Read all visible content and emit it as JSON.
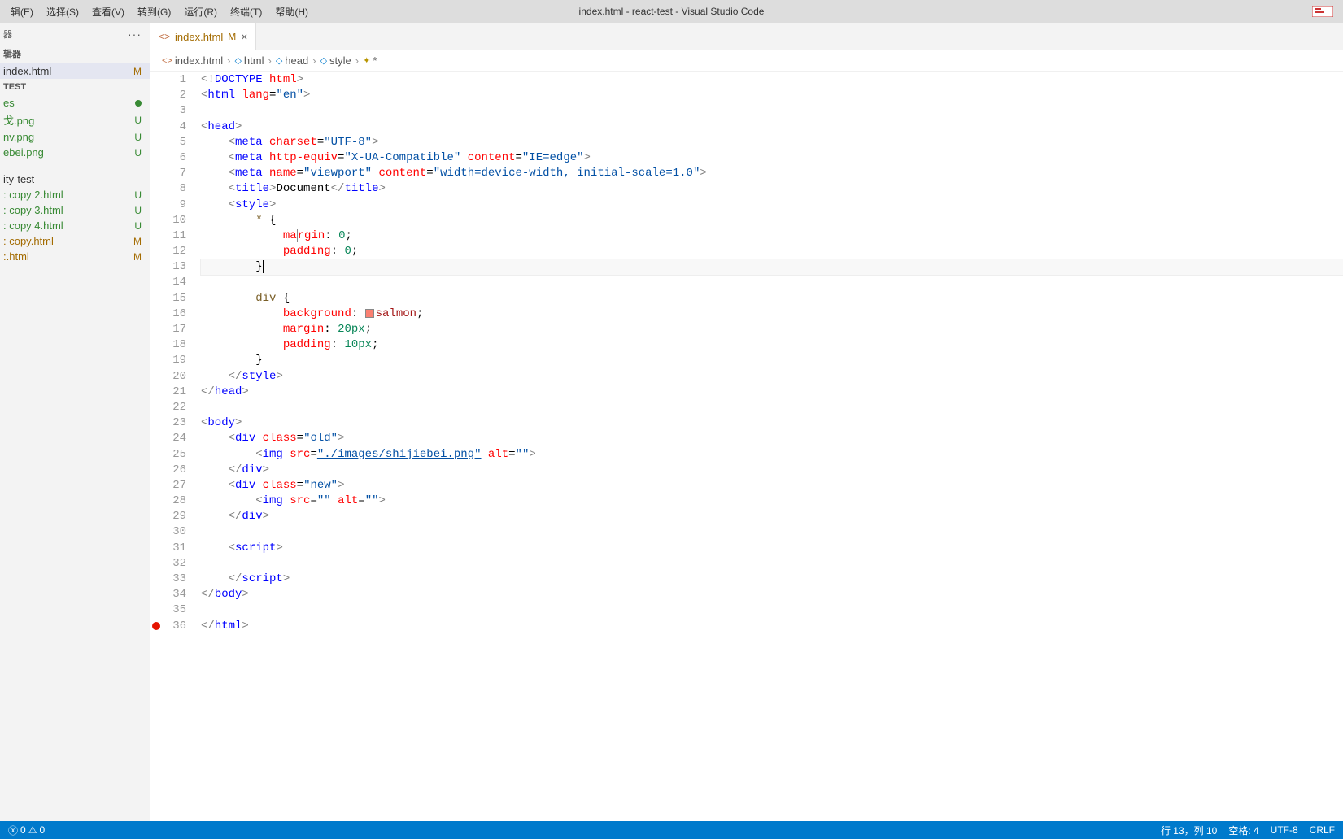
{
  "title": "index.html - react-test - Visual Studio Code",
  "menu": [
    "辑(E)",
    "选择(S)",
    "查看(V)",
    "转到(G)",
    "运行(R)",
    "终端(T)",
    "帮助(H)"
  ],
  "sidebar": {
    "header": "器",
    "section": "辑器",
    "testHeader": "TEST",
    "otherHeader": "ity-test",
    "files": [
      {
        "name": "index.html",
        "badge": "M",
        "badgeClass": "m",
        "selected": true
      },
      {
        "name": "es",
        "badge": "",
        "dot": true,
        "nameClass": "g"
      },
      {
        "name": "戈.png",
        "badge": "U",
        "badgeClass": "u",
        "nameClass": "g"
      },
      {
        "name": "nv.png",
        "badge": "U",
        "badgeClass": "u",
        "nameClass": "g"
      },
      {
        "name": "ebei.png",
        "badge": "U",
        "badgeClass": "u",
        "nameClass": "g"
      }
    ],
    "files2": [
      {
        "name": ": copy 2.html",
        "badge": "U",
        "badgeClass": "u",
        "nameClass": "g"
      },
      {
        "name": ": copy 3.html",
        "badge": "U",
        "badgeClass": "u",
        "nameClass": "g"
      },
      {
        "name": ": copy 4.html",
        "badge": "U",
        "badgeClass": "u",
        "nameClass": "g"
      },
      {
        "name": ": copy.html",
        "badge": "M",
        "badgeClass": "m",
        "nameClass": "m"
      },
      {
        "name": ":.html",
        "badge": "M",
        "badgeClass": "m",
        "nameClass": "m"
      }
    ]
  },
  "tab": {
    "name": "index.html",
    "badge": "M"
  },
  "breadcrumbs": [
    "index.html",
    "html",
    "head",
    "style",
    "*"
  ],
  "code": {
    "lines": 36,
    "img_path": "./images/shijiebei.png"
  },
  "status": {
    "errors": "0",
    "warnings": "0",
    "line": "行 13，列 10",
    "spaces": "空格: 4",
    "encoding": "UTF-8",
    "eol": "CRLF"
  }
}
